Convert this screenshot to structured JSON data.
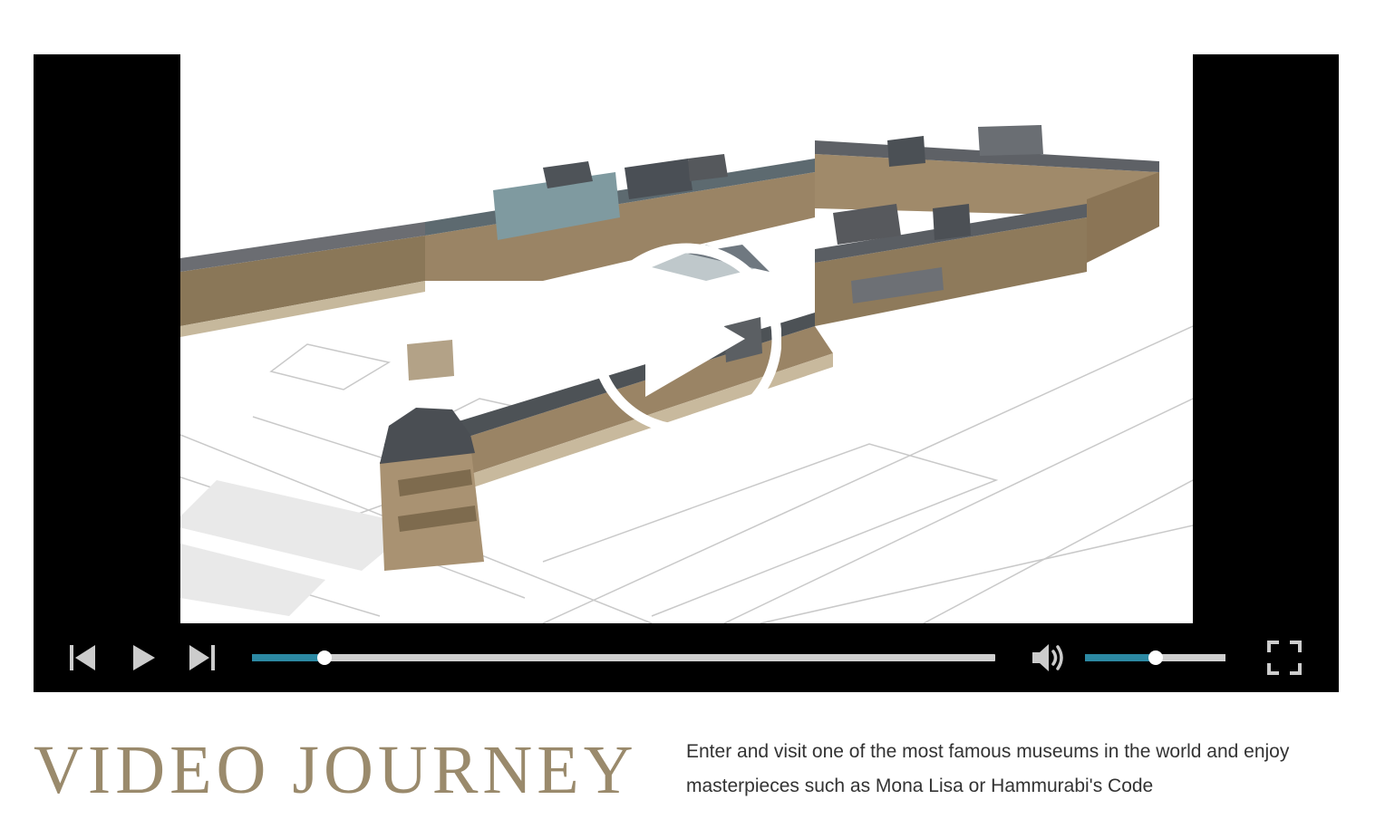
{
  "player": {
    "progress_fraction": 0.097,
    "volume_fraction": 0.5,
    "icons": {
      "big_play": "play-circle-icon",
      "previous": "skip-previous-icon",
      "play": "play-icon",
      "next": "skip-next-icon",
      "volume": "volume-icon",
      "fullscreen": "fullscreen-icon"
    },
    "colors": {
      "progress": "#2c89a3",
      "track": "#cfcfcf",
      "background": "#000000"
    }
  },
  "section": {
    "title": "VIDEO JOURNEY",
    "description": "Enter and visit one of the most famous museums in the world and enjoy masterpieces such as Mona Lisa or Hammurabi's Code",
    "title_color": "#9a8a6c"
  }
}
